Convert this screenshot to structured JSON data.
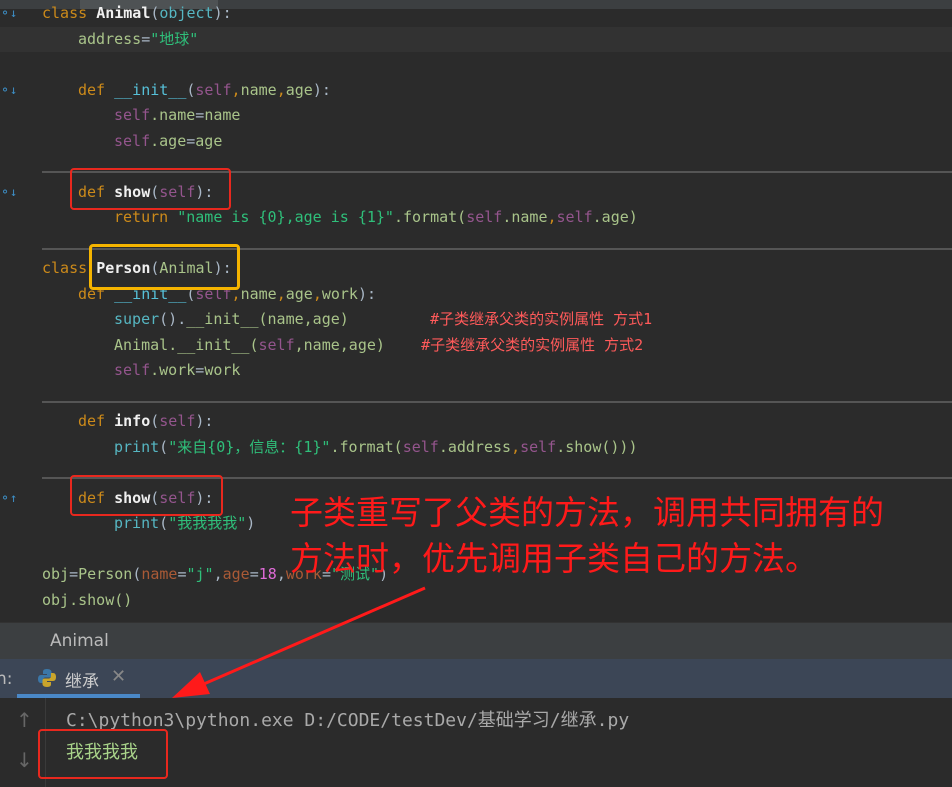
{
  "editor": {
    "lines": [
      [
        [
          "class ",
          "kw"
        ],
        [
          "Animal",
          "fnb"
        ],
        [
          "(",
          "punc"
        ],
        [
          "object",
          "cls"
        ],
        [
          "):",
          "punc"
        ]
      ],
      [
        [
          "address",
          "id"
        ],
        [
          "=",
          "punc"
        ],
        [
          "\"地球\"",
          "str"
        ]
      ],
      [],
      [
        [
          "def ",
          "kw"
        ],
        [
          "__init__",
          "fn"
        ],
        [
          "(",
          "punc"
        ],
        [
          "self",
          "self"
        ],
        [
          ",",
          "kw"
        ],
        [
          "name",
          "id"
        ],
        [
          ",",
          "kw"
        ],
        [
          "age",
          "id"
        ],
        [
          "):",
          "punc"
        ]
      ],
      [
        [
          "self",
          "self"
        ],
        [
          ".name",
          "id"
        ],
        [
          "=",
          "punc"
        ],
        [
          "name",
          "id"
        ]
      ],
      [
        [
          "self",
          "self"
        ],
        [
          ".age",
          "id"
        ],
        [
          "=",
          "punc"
        ],
        [
          "age",
          "id"
        ]
      ],
      [],
      [
        [
          "def ",
          "kw"
        ],
        [
          "show",
          "fnb"
        ],
        [
          "(",
          "punc"
        ],
        [
          "self",
          "self"
        ],
        [
          "):",
          "punc"
        ]
      ],
      [
        [
          "return ",
          "kw"
        ],
        [
          "\"name is {0},age is {1}\"",
          "str"
        ],
        [
          ".format(",
          "id"
        ],
        [
          "self",
          "self"
        ],
        [
          ".name",
          "id"
        ],
        [
          ",",
          "kw"
        ],
        [
          "self",
          "self"
        ],
        [
          ".age)",
          "id"
        ]
      ],
      [],
      [
        [
          "class ",
          "kw"
        ],
        [
          "Person",
          "fnb"
        ],
        [
          "(",
          "punc"
        ],
        [
          "Animal",
          "id"
        ],
        [
          "):",
          "punc"
        ]
      ],
      [
        [
          "def ",
          "kw"
        ],
        [
          "__init__",
          "fn"
        ],
        [
          "(",
          "punc"
        ],
        [
          "self",
          "self"
        ],
        [
          ",",
          "kw"
        ],
        [
          "name",
          "id"
        ],
        [
          ",",
          "kw"
        ],
        [
          "age",
          "id"
        ],
        [
          ",",
          "kw"
        ],
        [
          "work",
          "id"
        ],
        [
          "):",
          "punc"
        ]
      ],
      [
        [
          "super",
          "cls"
        ],
        [
          "().",
          "punc"
        ],
        [
          "__init__",
          "id"
        ],
        [
          "(name,age)",
          "id"
        ],
        [
          "         ",
          ""
        ],
        [
          "#子类继承父类的实例属性 方式1",
          "cm"
        ]
      ],
      [
        [
          "Animal",
          "id"
        ],
        [
          ".__init__(",
          "id"
        ],
        [
          "self",
          "self"
        ],
        [
          ",name,age)",
          "id"
        ],
        [
          "    ",
          ""
        ],
        [
          "#子类继承父类的实例属性 方式2",
          "cm"
        ]
      ],
      [
        [
          "self",
          "self"
        ],
        [
          ".work",
          "id"
        ],
        [
          "=",
          "punc"
        ],
        [
          "work",
          "id"
        ]
      ],
      [],
      [
        [
          "def ",
          "kw"
        ],
        [
          "info",
          "fnb"
        ],
        [
          "(",
          "punc"
        ],
        [
          "self",
          "self"
        ],
        [
          "):",
          "punc"
        ]
      ],
      [
        [
          "print",
          "cls"
        ],
        [
          "(",
          "punc"
        ],
        [
          "\"来自{0}，信息：{1}\"",
          "str"
        ],
        [
          ".format(",
          "id"
        ],
        [
          "self",
          "self"
        ],
        [
          ".address",
          "id"
        ],
        [
          ",",
          "kw"
        ],
        [
          "self",
          "self"
        ],
        [
          ".show()))",
          "id"
        ]
      ],
      [],
      [
        [
          "def ",
          "kw"
        ],
        [
          "show",
          "fnb"
        ],
        [
          "(",
          "punc"
        ],
        [
          "self",
          "self"
        ],
        [
          "):",
          "punc"
        ]
      ],
      [
        [
          "print",
          "cls"
        ],
        [
          "(",
          "punc"
        ],
        [
          "\"我我我我\"",
          "str"
        ],
        [
          ")",
          "punc"
        ]
      ],
      [],
      [
        [
          "obj",
          "id"
        ],
        [
          "=",
          "punc"
        ],
        [
          "Person",
          "id"
        ],
        [
          "(",
          "punc"
        ],
        [
          "name",
          "arg"
        ],
        [
          "=",
          "punc"
        ],
        [
          "\"j\"",
          "str"
        ],
        [
          ",",
          "punc"
        ],
        [
          "age",
          "arg"
        ],
        [
          "=",
          "punc"
        ],
        [
          "18",
          "num"
        ],
        [
          ",",
          "punc"
        ],
        [
          "work",
          "arg"
        ],
        [
          "=",
          "punc"
        ],
        [
          "\"测试\"",
          "str"
        ],
        [
          ")",
          "punc"
        ]
      ],
      [
        [
          "obj",
          "id"
        ],
        [
          ".show()",
          "id"
        ]
      ]
    ],
    "indents": [
      0,
      1,
      0,
      1,
      2,
      2,
      0,
      1,
      2,
      0,
      0,
      1,
      2,
      2,
      2,
      0,
      1,
      2,
      0,
      1,
      2,
      0,
      0,
      0
    ]
  },
  "breadcrumb": {
    "item": "Animal"
  },
  "run_panel": {
    "label": "n:",
    "tab_title": "继承",
    "close_icon": "close-icon",
    "tab_icon": "python-icon",
    "command": "C:\\python3\\python.exe D:/CODE/testDev/基础学习/继承.py",
    "output": "我我我我"
  },
  "annotation": {
    "line1": "子类重写了父类的方法，调用共同拥有的",
    "line2": "方法时，优先调用子类自己的方法。",
    "color": "#ff1a1a",
    "highlight_color": "#f5b400"
  }
}
